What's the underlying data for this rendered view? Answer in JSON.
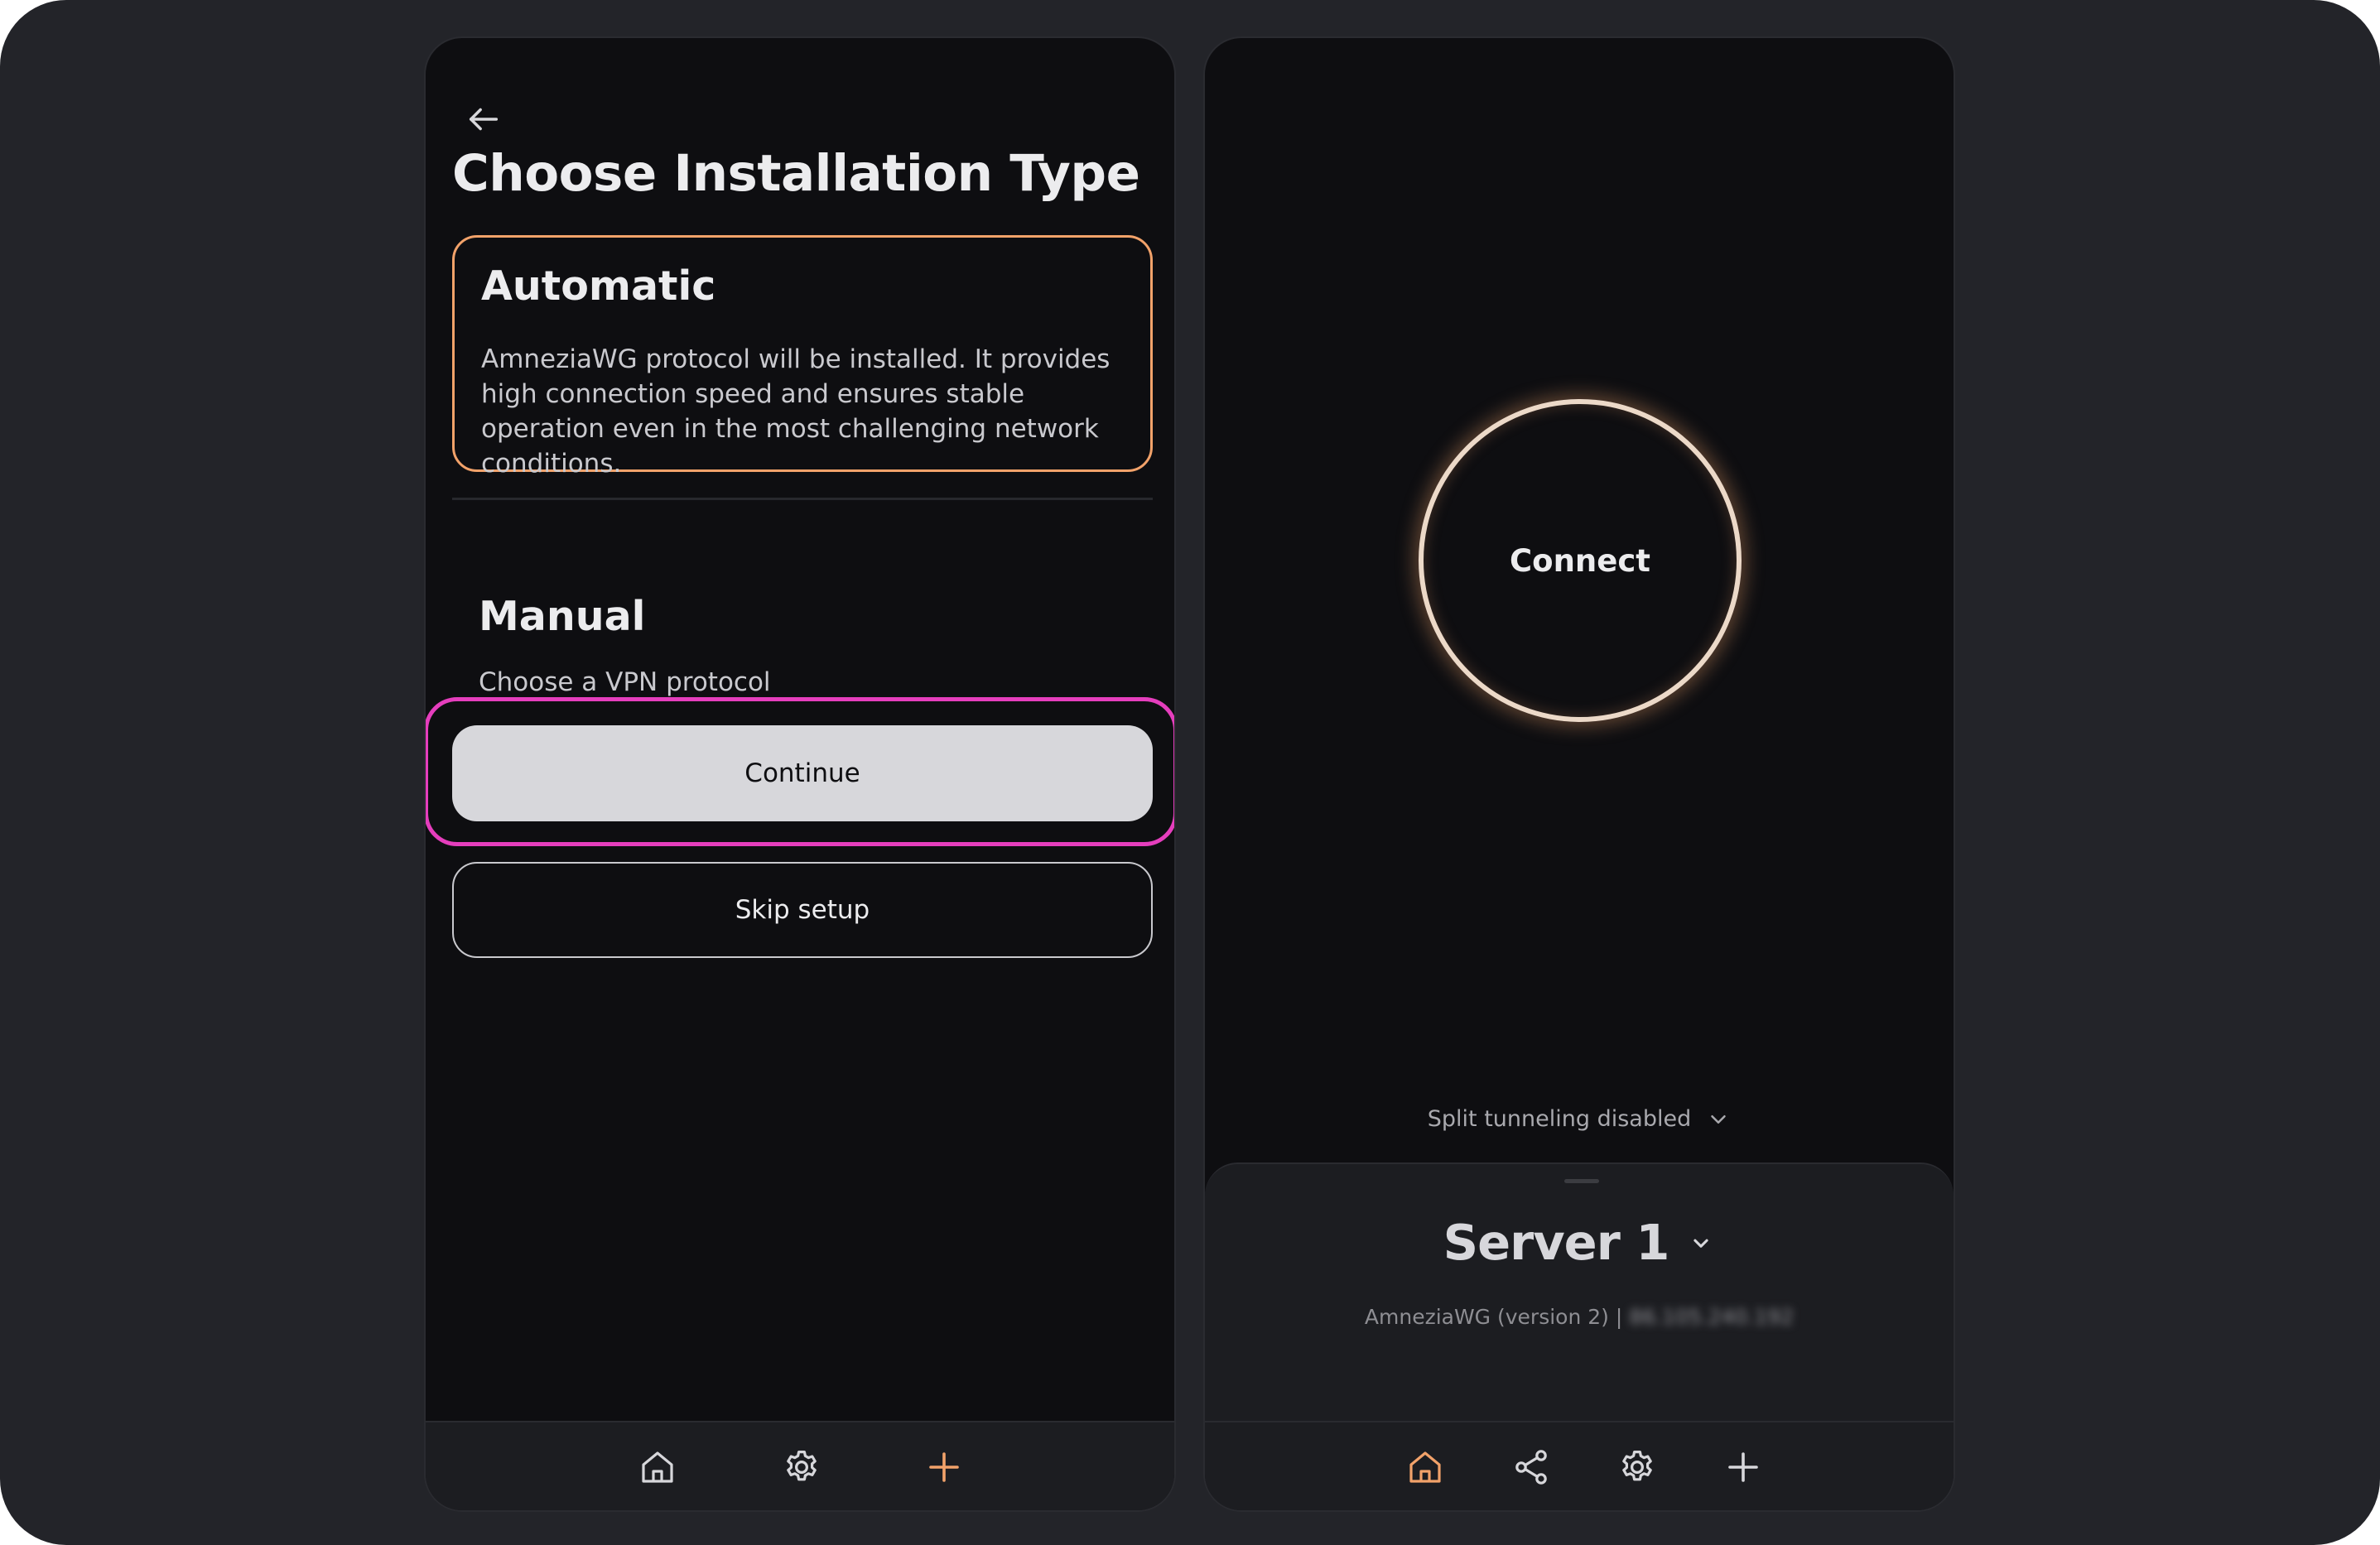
{
  "left_screen": {
    "title": "Choose Installation Type",
    "automatic": {
      "title": "Automatic",
      "description": "AmneziaWG protocol will be installed. It provides high connection speed and ensures stable operation even in the most challenging network conditions."
    },
    "manual": {
      "title": "Manual",
      "description": "Choose a VPN protocol"
    },
    "continue_label": "Continue",
    "skip_label": "Skip setup",
    "tabs": [
      "home-icon",
      "settings-icon",
      "add-icon"
    ]
  },
  "right_screen": {
    "connect_label": "Connect",
    "split_tunneling": "Split tunneling disabled",
    "server": {
      "name": "Server 1",
      "protocol": "AmneziaWG (version 2) |",
      "ip": "86.105.240.192"
    },
    "tabs": [
      "home-icon",
      "share-icon",
      "settings-icon",
      "add-icon"
    ]
  },
  "colors": {
    "accent": "#f2a26a",
    "highlight": "#e53ebd",
    "background": "#0e0e11"
  }
}
